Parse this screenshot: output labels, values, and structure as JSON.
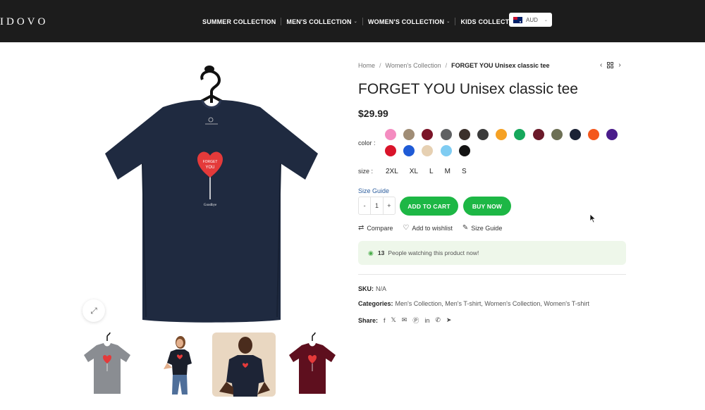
{
  "header": {
    "logo": "IDOVO",
    "nav": [
      {
        "label": "SUMMER COLLECTION",
        "dropdown": false
      },
      {
        "label": "MEN'S COLLECTION",
        "dropdown": true
      },
      {
        "label": "WOMEN'S COLLECTION",
        "dropdown": true
      },
      {
        "label": "KIDS COLLECTION",
        "dropdown": true
      }
    ],
    "currency": {
      "code": "AUD",
      "flag": "australia-flag-icon"
    }
  },
  "breadcrumb": {
    "home": "Home",
    "category": "Women's Collection",
    "current": "FORGET YOU Unisex classic tee"
  },
  "product": {
    "title": "FORGET YOU Unisex classic tee",
    "price": "$29.99",
    "color_label": "color :",
    "colors": [
      "#f48cc0",
      "#a08d76",
      "#7b1428",
      "#5f6163",
      "#3b302b",
      "#3a3a3a",
      "#f5a124",
      "#16a85c",
      "#6b1a2a",
      "#6d7055",
      "#1b2235",
      "#f4581d",
      "#4a1c8b",
      "#d9142a",
      "#1f5bd6",
      "#e6d0b2",
      "#7fccf2",
      "#141414"
    ],
    "size_label": "size :",
    "sizes": [
      "2XL",
      "XL",
      "L",
      "M",
      "S"
    ],
    "size_guide_link": "Size Guide",
    "quantity": {
      "minus": "-",
      "value": "1",
      "plus": "+"
    },
    "add_to_cart": "ADD TO CART",
    "buy_now": "BUY NOW",
    "actions": {
      "compare": "Compare",
      "wishlist": "Add to wishlist",
      "size_guide": "Size Guide"
    },
    "watchers": {
      "count": "13",
      "text": "People watching this product now!"
    },
    "sku_label": "SKU:",
    "sku_value": "N/A",
    "categories_label": "Categories:",
    "categories": "Men's Collection, Men's T-shirt, Women's Collection, Women's T-shirt",
    "share_label": "Share:",
    "share_icons": [
      "facebook-icon",
      "x-icon",
      "email-icon",
      "pinterest-icon",
      "linkedin-icon",
      "whatsapp-icon",
      "telegram-icon"
    ],
    "shirt_print": {
      "top": "FORGET",
      "middle": "YOU",
      "bottom": "Goodbye"
    }
  },
  "gallery": {
    "thumbnails": [
      {
        "name": "grey-tee-thumbnail"
      },
      {
        "name": "woman-model-thumbnail"
      },
      {
        "name": "man-model-thumbnail"
      },
      {
        "name": "maroon-tee-thumbnail"
      }
    ]
  }
}
